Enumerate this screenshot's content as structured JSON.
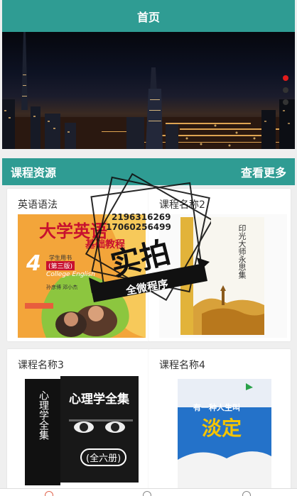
{
  "header": {
    "title": "首页"
  },
  "banner": {
    "indicator_count": 3,
    "active_index": 0
  },
  "section": {
    "title": "课程资源",
    "more_label": "查看更多"
  },
  "courses": [
    {
      "name": "英语语法",
      "cover": {
        "title": "大学英语",
        "subtitle": "基础教程",
        "volume": "4",
        "badge": "学生用书",
        "edition": "(第三版)",
        "english": "College English",
        "authors": "孙彦博 邓小杰"
      }
    },
    {
      "name": "课程名称2",
      "cover": {
        "title": "印光大师永思集"
      }
    },
    {
      "name": "课程名称3",
      "cover": {
        "title": "心理学全集",
        "spine": "心理学全集",
        "note": "(全六册)"
      }
    },
    {
      "name": "课程名称4",
      "cover": {
        "title": "有一种人生叫",
        "big": "淡定"
      }
    }
  ],
  "watermark": {
    "main": "实拍",
    "phone1": "2196316269",
    "phone2": "17060256499",
    "ribbon": "全微程序"
  },
  "colors": {
    "primary": "#2f9c93",
    "indicator_active": "#e21b1b"
  }
}
